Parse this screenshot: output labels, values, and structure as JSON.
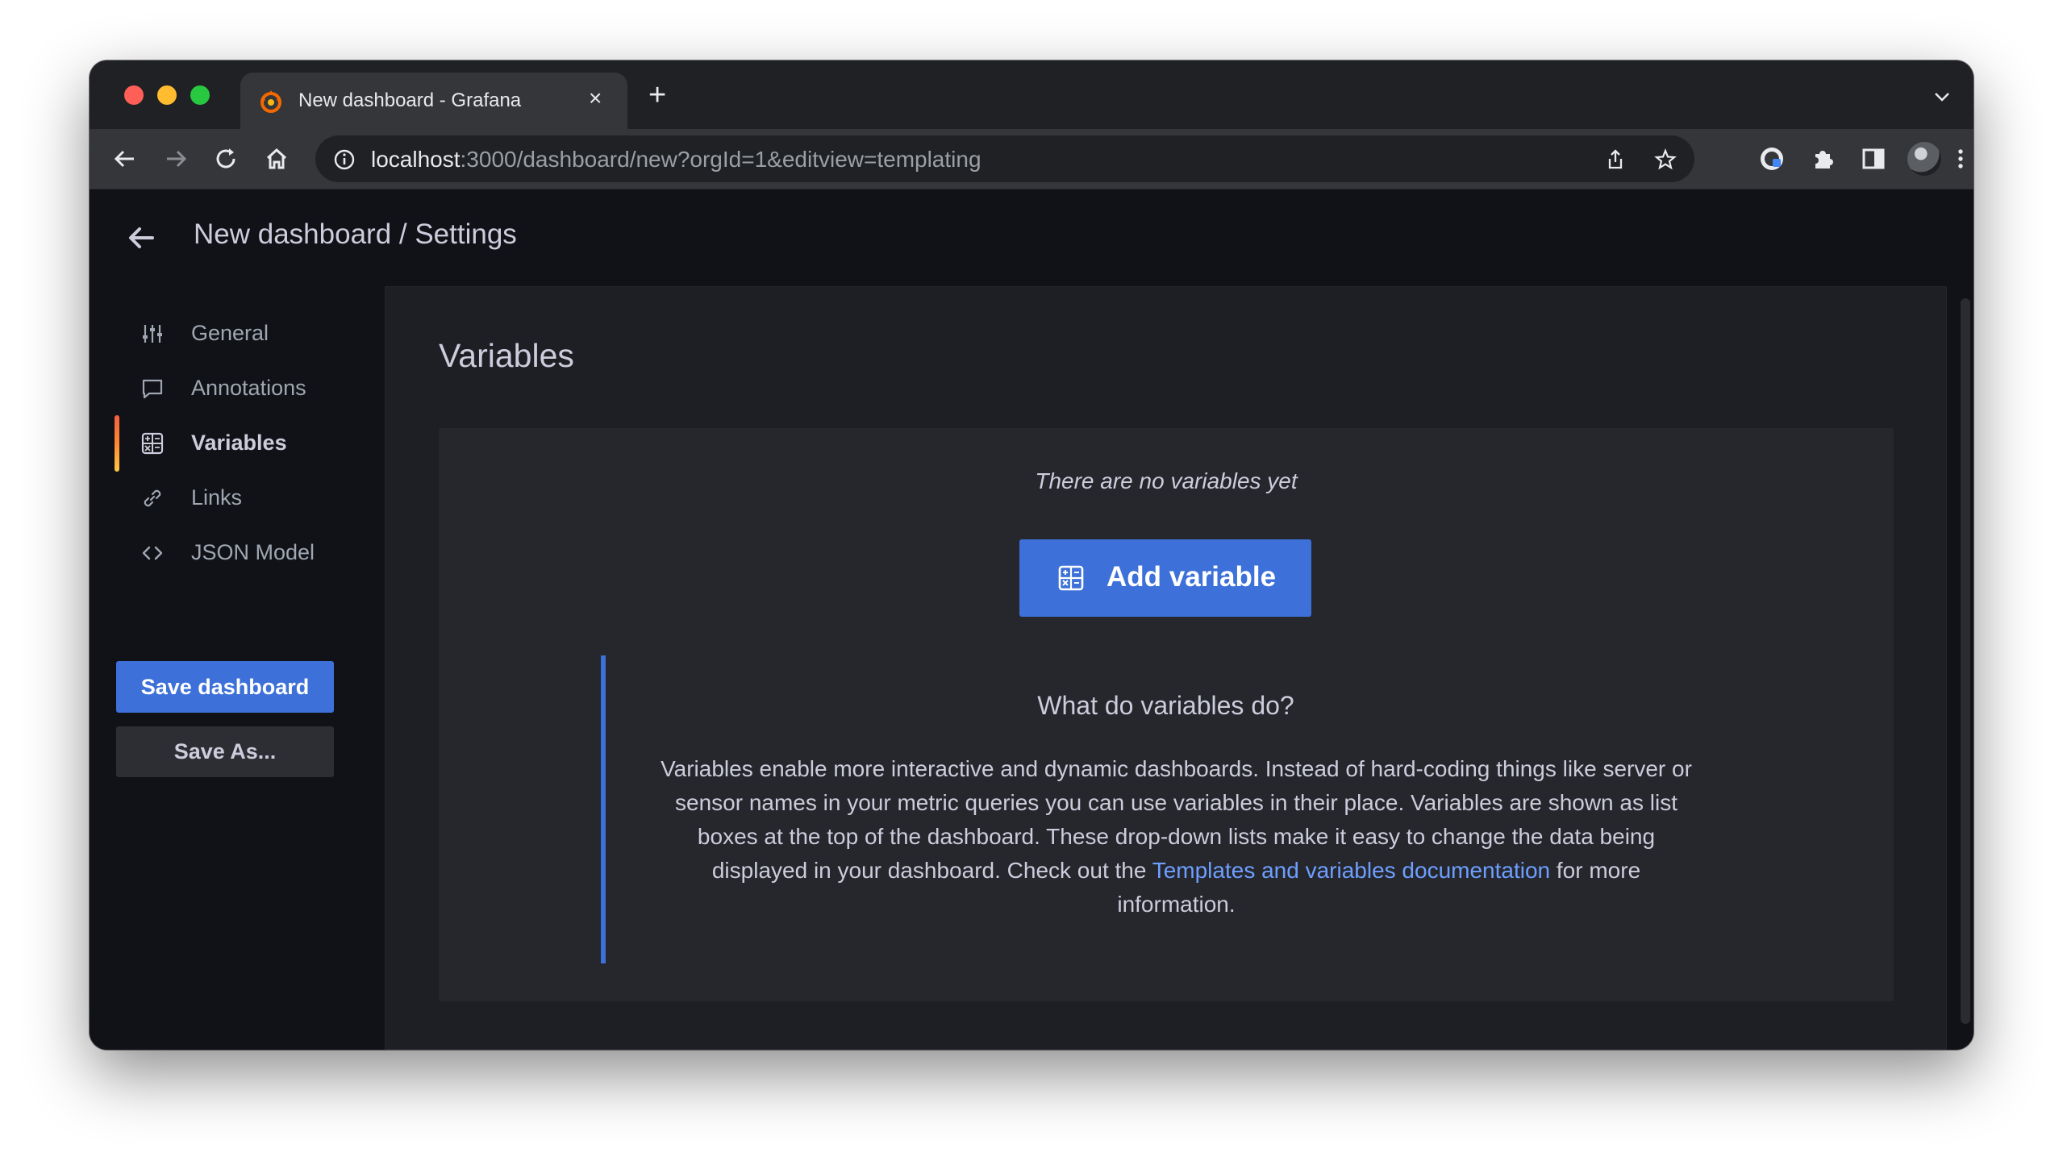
{
  "browser": {
    "tab_title": "New dashboard - Grafana",
    "url_host": "localhost",
    "url_rest": ":3000/dashboard/new?orgId=1&editview=templating"
  },
  "page": {
    "title": "New dashboard / Settings"
  },
  "sidebar": {
    "items": [
      {
        "label": "General",
        "icon": "sliders-icon",
        "active": false
      },
      {
        "label": "Annotations",
        "icon": "comment-icon",
        "active": false
      },
      {
        "label": "Variables",
        "icon": "calculator-icon",
        "active": true
      },
      {
        "label": "Links",
        "icon": "link-icon",
        "active": false
      },
      {
        "label": "JSON Model",
        "icon": "code-brackets-icon",
        "active": false
      }
    ],
    "save_label": "Save dashboard",
    "save_as_label": "Save As..."
  },
  "main": {
    "title": "Variables",
    "empty_text": "There are no variables yet",
    "add_button_label": "Add variable",
    "help_title": "What do variables do?",
    "help_body_before": "Variables enable more interactive and dynamic dashboards. Instead of hard-coding things like server or sensor names in your metric queries you can use variables in their place. Variables are shown as list boxes at the top of the dashboard. These drop-down lists make it easy to change the data being displayed in your dashboard. Check out the ",
    "help_link": "Templates and variables documentation",
    "help_body_after": " for more information."
  },
  "colors": {
    "primary_button": "#3d71d9",
    "link": "#6e9fff",
    "page_bg": "#111217",
    "panel_bg": "#1e1f24"
  }
}
